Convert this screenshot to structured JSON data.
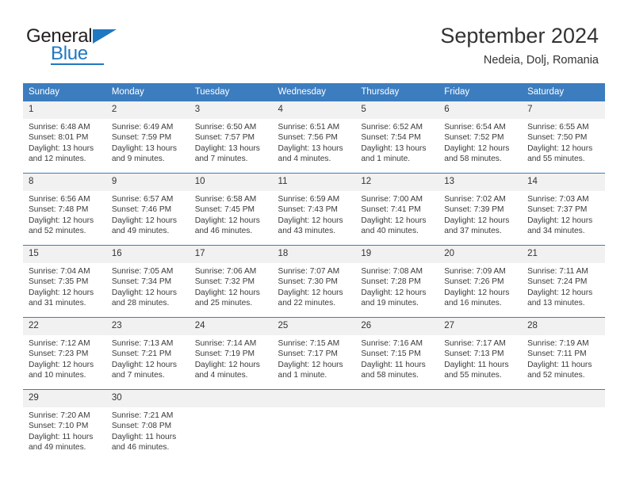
{
  "brand": {
    "name_part1": "General",
    "name_part2": "Blue"
  },
  "header": {
    "title": "September 2024",
    "subtitle": "Nedeia, Dolj, Romania"
  },
  "weekdays": [
    "Sunday",
    "Monday",
    "Tuesday",
    "Wednesday",
    "Thursday",
    "Friday",
    "Saturday"
  ],
  "colors": {
    "header_blue": "#3c7dbf",
    "daynum_band": "#f1f1f1",
    "brand_blue": "#1f78c1",
    "text": "#333333"
  },
  "weeks": [
    [
      {
        "day": "1",
        "sunrise": "Sunrise: 6:48 AM",
        "sunset": "Sunset: 8:01 PM",
        "daylight1": "Daylight: 13 hours",
        "daylight2": "and 12 minutes."
      },
      {
        "day": "2",
        "sunrise": "Sunrise: 6:49 AM",
        "sunset": "Sunset: 7:59 PM",
        "daylight1": "Daylight: 13 hours",
        "daylight2": "and 9 minutes."
      },
      {
        "day": "3",
        "sunrise": "Sunrise: 6:50 AM",
        "sunset": "Sunset: 7:57 PM",
        "daylight1": "Daylight: 13 hours",
        "daylight2": "and 7 minutes."
      },
      {
        "day": "4",
        "sunrise": "Sunrise: 6:51 AM",
        "sunset": "Sunset: 7:56 PM",
        "daylight1": "Daylight: 13 hours",
        "daylight2": "and 4 minutes."
      },
      {
        "day": "5",
        "sunrise": "Sunrise: 6:52 AM",
        "sunset": "Sunset: 7:54 PM",
        "daylight1": "Daylight: 13 hours",
        "daylight2": "and 1 minute."
      },
      {
        "day": "6",
        "sunrise": "Sunrise: 6:54 AM",
        "sunset": "Sunset: 7:52 PM",
        "daylight1": "Daylight: 12 hours",
        "daylight2": "and 58 minutes."
      },
      {
        "day": "7",
        "sunrise": "Sunrise: 6:55 AM",
        "sunset": "Sunset: 7:50 PM",
        "daylight1": "Daylight: 12 hours",
        "daylight2": "and 55 minutes."
      }
    ],
    [
      {
        "day": "8",
        "sunrise": "Sunrise: 6:56 AM",
        "sunset": "Sunset: 7:48 PM",
        "daylight1": "Daylight: 12 hours",
        "daylight2": "and 52 minutes."
      },
      {
        "day": "9",
        "sunrise": "Sunrise: 6:57 AM",
        "sunset": "Sunset: 7:46 PM",
        "daylight1": "Daylight: 12 hours",
        "daylight2": "and 49 minutes."
      },
      {
        "day": "10",
        "sunrise": "Sunrise: 6:58 AM",
        "sunset": "Sunset: 7:45 PM",
        "daylight1": "Daylight: 12 hours",
        "daylight2": "and 46 minutes."
      },
      {
        "day": "11",
        "sunrise": "Sunrise: 6:59 AM",
        "sunset": "Sunset: 7:43 PM",
        "daylight1": "Daylight: 12 hours",
        "daylight2": "and 43 minutes."
      },
      {
        "day": "12",
        "sunrise": "Sunrise: 7:00 AM",
        "sunset": "Sunset: 7:41 PM",
        "daylight1": "Daylight: 12 hours",
        "daylight2": "and 40 minutes."
      },
      {
        "day": "13",
        "sunrise": "Sunrise: 7:02 AM",
        "sunset": "Sunset: 7:39 PM",
        "daylight1": "Daylight: 12 hours",
        "daylight2": "and 37 minutes."
      },
      {
        "day": "14",
        "sunrise": "Sunrise: 7:03 AM",
        "sunset": "Sunset: 7:37 PM",
        "daylight1": "Daylight: 12 hours",
        "daylight2": "and 34 minutes."
      }
    ],
    [
      {
        "day": "15",
        "sunrise": "Sunrise: 7:04 AM",
        "sunset": "Sunset: 7:35 PM",
        "daylight1": "Daylight: 12 hours",
        "daylight2": "and 31 minutes."
      },
      {
        "day": "16",
        "sunrise": "Sunrise: 7:05 AM",
        "sunset": "Sunset: 7:34 PM",
        "daylight1": "Daylight: 12 hours",
        "daylight2": "and 28 minutes."
      },
      {
        "day": "17",
        "sunrise": "Sunrise: 7:06 AM",
        "sunset": "Sunset: 7:32 PM",
        "daylight1": "Daylight: 12 hours",
        "daylight2": "and 25 minutes."
      },
      {
        "day": "18",
        "sunrise": "Sunrise: 7:07 AM",
        "sunset": "Sunset: 7:30 PM",
        "daylight1": "Daylight: 12 hours",
        "daylight2": "and 22 minutes."
      },
      {
        "day": "19",
        "sunrise": "Sunrise: 7:08 AM",
        "sunset": "Sunset: 7:28 PM",
        "daylight1": "Daylight: 12 hours",
        "daylight2": "and 19 minutes."
      },
      {
        "day": "20",
        "sunrise": "Sunrise: 7:09 AM",
        "sunset": "Sunset: 7:26 PM",
        "daylight1": "Daylight: 12 hours",
        "daylight2": "and 16 minutes."
      },
      {
        "day": "21",
        "sunrise": "Sunrise: 7:11 AM",
        "sunset": "Sunset: 7:24 PM",
        "daylight1": "Daylight: 12 hours",
        "daylight2": "and 13 minutes."
      }
    ],
    [
      {
        "day": "22",
        "sunrise": "Sunrise: 7:12 AM",
        "sunset": "Sunset: 7:23 PM",
        "daylight1": "Daylight: 12 hours",
        "daylight2": "and 10 minutes."
      },
      {
        "day": "23",
        "sunrise": "Sunrise: 7:13 AM",
        "sunset": "Sunset: 7:21 PM",
        "daylight1": "Daylight: 12 hours",
        "daylight2": "and 7 minutes."
      },
      {
        "day": "24",
        "sunrise": "Sunrise: 7:14 AM",
        "sunset": "Sunset: 7:19 PM",
        "daylight1": "Daylight: 12 hours",
        "daylight2": "and 4 minutes."
      },
      {
        "day": "25",
        "sunrise": "Sunrise: 7:15 AM",
        "sunset": "Sunset: 7:17 PM",
        "daylight1": "Daylight: 12 hours",
        "daylight2": "and 1 minute."
      },
      {
        "day": "26",
        "sunrise": "Sunrise: 7:16 AM",
        "sunset": "Sunset: 7:15 PM",
        "daylight1": "Daylight: 11 hours",
        "daylight2": "and 58 minutes."
      },
      {
        "day": "27",
        "sunrise": "Sunrise: 7:17 AM",
        "sunset": "Sunset: 7:13 PM",
        "daylight1": "Daylight: 11 hours",
        "daylight2": "and 55 minutes."
      },
      {
        "day": "28",
        "sunrise": "Sunrise: 7:19 AM",
        "sunset": "Sunset: 7:11 PM",
        "daylight1": "Daylight: 11 hours",
        "daylight2": "and 52 minutes."
      }
    ],
    [
      {
        "day": "29",
        "sunrise": "Sunrise: 7:20 AM",
        "sunset": "Sunset: 7:10 PM",
        "daylight1": "Daylight: 11 hours",
        "daylight2": "and 49 minutes."
      },
      {
        "day": "30",
        "sunrise": "Sunrise: 7:21 AM",
        "sunset": "Sunset: 7:08 PM",
        "daylight1": "Daylight: 11 hours",
        "daylight2": "and 46 minutes."
      },
      {
        "day": "",
        "sunrise": "",
        "sunset": "",
        "daylight1": "",
        "daylight2": ""
      },
      {
        "day": "",
        "sunrise": "",
        "sunset": "",
        "daylight1": "",
        "daylight2": ""
      },
      {
        "day": "",
        "sunrise": "",
        "sunset": "",
        "daylight1": "",
        "daylight2": ""
      },
      {
        "day": "",
        "sunrise": "",
        "sunset": "",
        "daylight1": "",
        "daylight2": ""
      },
      {
        "day": "",
        "sunrise": "",
        "sunset": "",
        "daylight1": "",
        "daylight2": ""
      }
    ]
  ]
}
